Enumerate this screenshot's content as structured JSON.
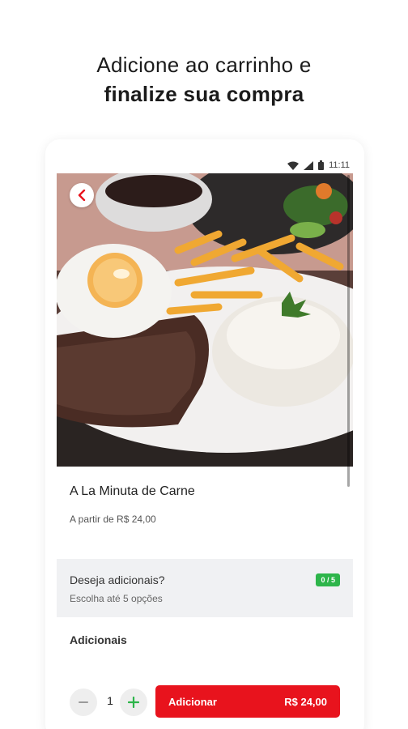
{
  "headline": {
    "line1": "Adicione ao carrinho e",
    "line2": "finalize sua compra"
  },
  "status_bar": {
    "time": "11:11",
    "icons": [
      "wifi-icon",
      "signal-icon",
      "battery-icon"
    ]
  },
  "hero": {
    "image_desc": "plate of steak with fried egg, fries, rice and beans",
    "back_icon": "chevron-left-icon"
  },
  "product": {
    "name": "A La Minuta de Carne",
    "price_from": "A partir de R$ 24,00"
  },
  "addons": {
    "question": "Deseja adicionais?",
    "hint": "Escolha até 5 opções",
    "counter": "0 / 5",
    "section_label": "Adicionais"
  },
  "footer": {
    "quantity": "1",
    "add_label": "Adicionar",
    "total": "R$ 24,00"
  },
  "colors": {
    "accent_red": "#e8131d",
    "badge_green": "#2db54a",
    "plus_green": "#2db54a"
  }
}
